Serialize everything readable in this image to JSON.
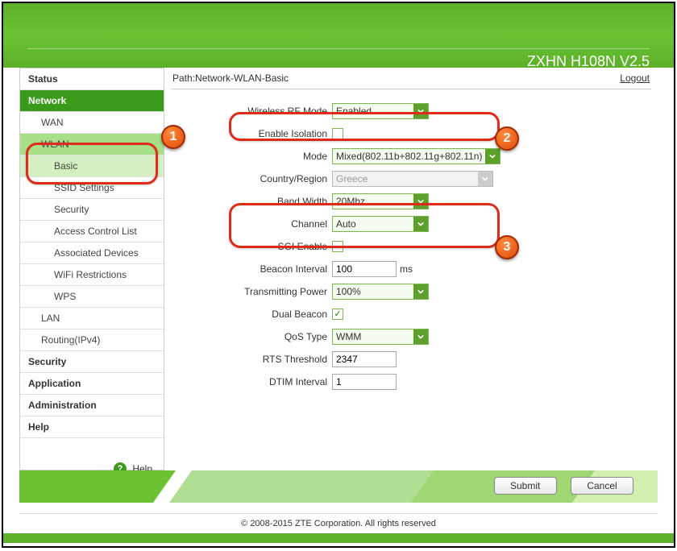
{
  "header": {
    "title": "ZXHN H108N V2.5"
  },
  "path": {
    "prefix": "Path:",
    "value": "Network-WLAN-Basic",
    "logout": "Logout"
  },
  "sidebar": {
    "items": [
      {
        "label": "Status",
        "level": 1
      },
      {
        "label": "Network",
        "level": 1,
        "active": true
      },
      {
        "label": "WAN",
        "level": 2
      },
      {
        "label": "WLAN",
        "level": 2,
        "activeGroup": true
      },
      {
        "label": "Basic",
        "level": 3,
        "activeSub": true
      },
      {
        "label": "SSID Settings",
        "level": 3
      },
      {
        "label": "Security",
        "level": 3
      },
      {
        "label": "Access Control List",
        "level": 3
      },
      {
        "label": "Associated Devices",
        "level": 3
      },
      {
        "label": "WiFi Restrictions",
        "level": 3
      },
      {
        "label": "WPS",
        "level": 3
      },
      {
        "label": "LAN",
        "level": 2
      },
      {
        "label": "Routing(IPv4)",
        "level": 2
      },
      {
        "label": "Security",
        "level": 1
      },
      {
        "label": "Application",
        "level": 1
      },
      {
        "label": "Administration",
        "level": 1
      },
      {
        "label": "Help",
        "level": 1
      }
    ],
    "help": "Help"
  },
  "form": {
    "wireless_rf_mode": {
      "label": "Wireless RF Mode",
      "value": "Enabled"
    },
    "enable_isolation": {
      "label": "Enable Isolation",
      "checked": false
    },
    "mode": {
      "label": "Mode",
      "value": "Mixed(802.11b+802.11g+802.11n)"
    },
    "country_region": {
      "label": "Country/Region",
      "value": "Greece",
      "disabled": true
    },
    "band_width": {
      "label": "Band Width",
      "value": "20Mhz"
    },
    "channel": {
      "label": "Channel",
      "value": "Auto"
    },
    "sgi_enable": {
      "label": "SGI Enable",
      "checked": false
    },
    "beacon_interval": {
      "label": "Beacon Interval",
      "value": "100",
      "unit": "ms"
    },
    "transmitting_power": {
      "label": "Transmitting Power",
      "value": "100%"
    },
    "dual_beacon": {
      "label": "Dual Beacon",
      "checked": true
    },
    "qos_type": {
      "label": "QoS Type",
      "value": "WMM"
    },
    "rts_threshold": {
      "label": "RTS Threshold",
      "value": "2347"
    },
    "dtim_interval": {
      "label": "DTIM Interval",
      "value": "1"
    }
  },
  "buttons": {
    "submit": "Submit",
    "cancel": "Cancel"
  },
  "footer": {
    "copyright": "© 2008-2015 ZTE Corporation. All rights reserved"
  },
  "annotations": {
    "b1": "1",
    "b2": "2",
    "b3": "3"
  }
}
